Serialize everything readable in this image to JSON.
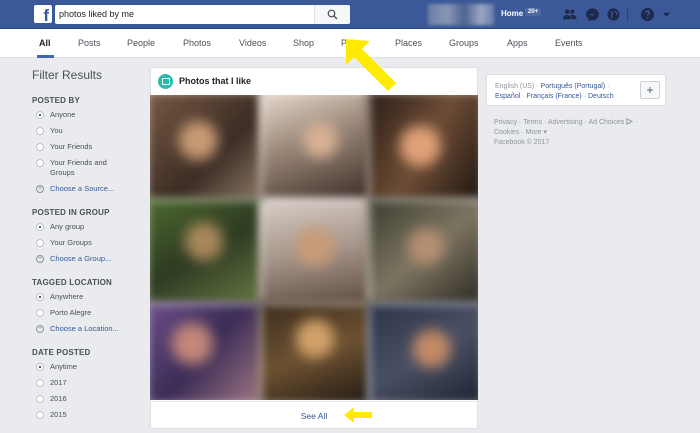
{
  "header": {
    "logo": "f",
    "search_value": "photos liked by me",
    "home_label": "Home",
    "home_badge": "20+"
  },
  "tabs": [
    {
      "label": "All",
      "active": true
    },
    {
      "label": "Posts"
    },
    {
      "label": "People"
    },
    {
      "label": "Photos"
    },
    {
      "label": "Videos"
    },
    {
      "label": "Shop"
    },
    {
      "label": "P"
    },
    {
      "label": "Places"
    },
    {
      "label": "Groups"
    },
    {
      "label": "Apps"
    },
    {
      "label": "Events"
    }
  ],
  "filters": {
    "title": "Filter Results",
    "posted_by": {
      "heading": "POSTED BY",
      "options": [
        "Anyone",
        "You",
        "Your Friends",
        "Your Friends and Groups"
      ],
      "selected": 0,
      "choose": "Choose a Source..."
    },
    "posted_in_group": {
      "heading": "POSTED IN GROUP",
      "options": [
        "Any group",
        "Your Groups"
      ],
      "selected": 0,
      "choose": "Choose a Group..."
    },
    "tagged_location": {
      "heading": "TAGGED LOCATION",
      "options": [
        "Anywhere",
        "Porto Alegre"
      ],
      "selected": 0,
      "choose": "Choose a Location..."
    },
    "date_posted": {
      "heading": "DATE POSTED",
      "options": [
        "Anytime",
        "2017",
        "2016",
        "2015"
      ],
      "selected": 0
    }
  },
  "results_card": {
    "title": "Photos that I like",
    "see_all": "See All"
  },
  "languages": {
    "current": "English (US)",
    "links": [
      "Português (Portugal)",
      "Español",
      "Français (France)",
      "Deutsch"
    ],
    "add_symbol": "+"
  },
  "footer": {
    "links": [
      "Privacy",
      "Terms",
      "Advertising",
      "Ad Choices",
      "Cookies",
      "More"
    ],
    "copyright": "Facebook © 2017"
  },
  "colors": {
    "brand": "#3b5998",
    "link": "#365899",
    "annotation_arrow": "#ffeb00"
  },
  "icons": [
    "facebook-logo-icon",
    "search-icon",
    "friends-icon",
    "messenger-icon",
    "globe-icon",
    "help-icon",
    "caret-down-icon",
    "photo-icon",
    "ad-choices-icon"
  ]
}
